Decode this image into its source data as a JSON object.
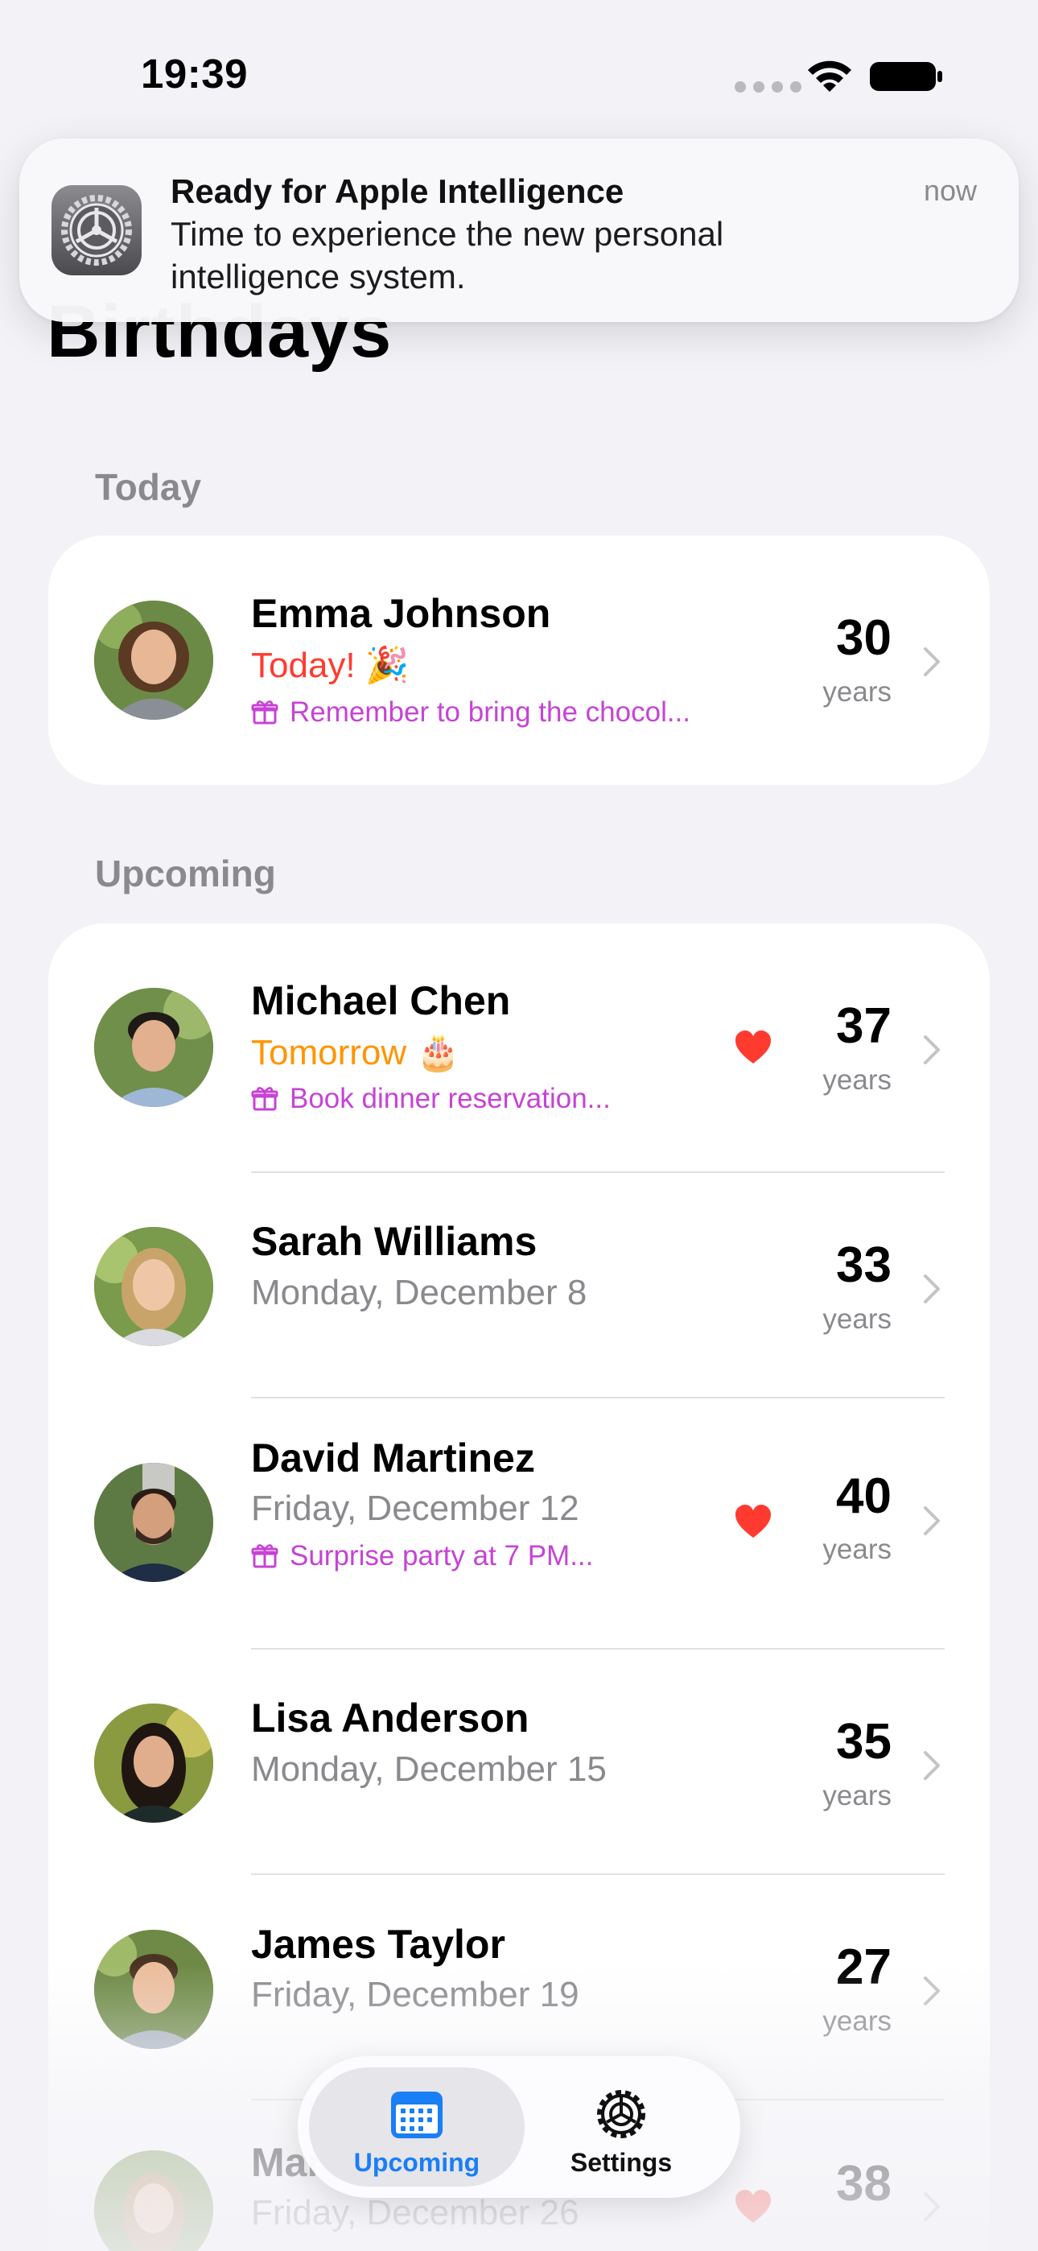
{
  "status_bar": {
    "time": "19:39"
  },
  "page": {
    "title": "Birthdays"
  },
  "notification": {
    "title": "Ready for Apple Intelligence",
    "body": "Time to experience the new personal intelligence system.",
    "time": "now",
    "app_icon": "settings-gear-icon"
  },
  "sections": {
    "today": "Today",
    "upcoming": "Upcoming"
  },
  "today": [
    {
      "name": "Emma Johnson",
      "date": "Today! 🎉",
      "note": "Remember to bring the chocol...",
      "age": "30",
      "unit": "years",
      "favorite": false
    }
  ],
  "upcoming": [
    {
      "name": "Michael Chen",
      "date": "Tomorrow 🎂",
      "note": "Book dinner reservation...",
      "age": "37",
      "unit": "years",
      "favorite": true
    },
    {
      "name": "Sarah Williams",
      "date": "Monday, December 8",
      "note": "",
      "age": "33",
      "unit": "years",
      "favorite": false
    },
    {
      "name": "David Martinez",
      "date": "Friday, December 12",
      "note": "Surprise party at 7 PM...",
      "age": "40",
      "unit": "years",
      "favorite": true
    },
    {
      "name": "Lisa Anderson",
      "date": "Monday, December 15",
      "note": "",
      "age": "35",
      "unit": "years",
      "favorite": false
    },
    {
      "name": "James Taylor",
      "date": "Friday, December 19",
      "note": "",
      "age": "27",
      "unit": "years",
      "favorite": false
    },
    {
      "name": "Mar",
      "date": "Friday, December 26",
      "note": "",
      "age": "38",
      "unit": "years",
      "favorite": true
    }
  ],
  "tab_bar": {
    "upcoming": "Upcoming",
    "settings": "Settings"
  },
  "colors": {
    "background": "#f2f2f7",
    "today_red": "#ff3b30",
    "tomorrow_orange": "#ff9500",
    "note_purple": "#c643d5",
    "tab_blue": "#1a7ef5",
    "heart_red": "#ff3b30"
  }
}
